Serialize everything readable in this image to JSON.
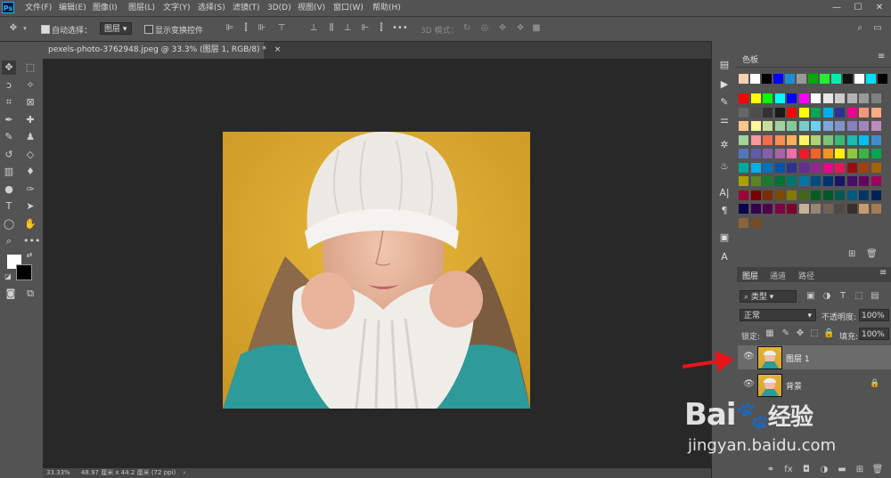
{
  "menu": [
    "文件(F)",
    "编辑(E)",
    "图像(I)",
    "图层(L)",
    "文字(Y)",
    "选择(S)",
    "滤镜(T)",
    "3D(D)",
    "视图(V)",
    "窗口(W)",
    "帮助(H)"
  ],
  "app_logo": "Ps",
  "options": {
    "auto_select_label": "自动选择：",
    "auto_select_target": "图层",
    "show_transform_label": "显示变换控件",
    "more": "•••",
    "mode_3d_label": "3D 模式："
  },
  "document": {
    "tab_title": "pexels-photo-3762948.jpeg @ 33.3% (图层 1, RGB/8) *",
    "close": "×"
  },
  "status": {
    "zoom": "33.33%",
    "doc_info": "48.97 厘米 x 44.2 厘米 (72 ppi)",
    "arrow": "›"
  },
  "swatches": {
    "title": "色板",
    "row0": [
      "#f5d2b5",
      "#ffffff",
      "#000000",
      "#0000ff",
      "#1b8fd1",
      "#999999",
      "#00aa00",
      "#22ee33",
      "#00eeaa",
      "#111111",
      "#ffffff",
      "#00ddff",
      "#000000"
    ],
    "rows": [
      [
        "#ff0000",
        "#ffff00",
        "#00ff00",
        "#00ffff",
        "#0000ff",
        "#ff00ff",
        "#ffffff",
        "#e6e6e6",
        "#cccccc",
        "#b3b3b3",
        "#999999",
        "#808080"
      ],
      [
        "#666666",
        "#4d4d4d",
        "#333333",
        "#1a1a1a",
        "#ff0000",
        "#ffff00",
        "#00a651",
        "#00aeef",
        "#2e3192",
        "#ec008c",
        "#f7977a",
        "#fbad82"
      ],
      [
        "#fdc68a",
        "#fff79a",
        "#c4df9b",
        "#a3d39c",
        "#82ca9c",
        "#7accc8",
        "#6dcff6",
        "#7da7d9",
        "#8393ca",
        "#8781bd",
        "#a186be",
        "#bd8cbf"
      ],
      [
        "#a2d39c",
        "#f6989d",
        "#f26c4f",
        "#f68e55",
        "#fbaf5c",
        "#fff467",
        "#acd372",
        "#7cc576",
        "#3bb878",
        "#1abbb4",
        "#00bff3",
        "#438ccb"
      ],
      [
        "#5574b9",
        "#605ca8",
        "#855fa8",
        "#a763a8",
        "#f06eaa",
        "#ed1c24",
        "#f26522",
        "#f7941d",
        "#fff200",
        "#8dc73f",
        "#39b54a",
        "#00a651"
      ],
      [
        "#00a99d",
        "#00aeef",
        "#0072bc",
        "#0054a6",
        "#2e3192",
        "#662d91",
        "#92278f",
        "#ec008c",
        "#ed145b",
        "#9e0b0f",
        "#a0410d",
        "#a3620a"
      ],
      [
        "#aba000",
        "#598527",
        "#1a7b30",
        "#007236",
        "#00746b",
        "#0076a3",
        "#004b80",
        "#003471",
        "#1b1464",
        "#440e62",
        "#630460",
        "#9e005d"
      ],
      [
        "#9e0039",
        "#790000",
        "#7b2e00",
        "#7d4900",
        "#827b00",
        "#406618",
        "#005e20",
        "#005826",
        "#005952",
        "#005b7f",
        "#003663",
        "#002157"
      ],
      [
        "#0d004c",
        "#32004b",
        "#4b0049",
        "#7b0046",
        "#7a0026",
        "#c7b299",
        "#998675",
        "#736357",
        "#534741",
        "#37302d",
        "#c69c6d",
        "#a67c52"
      ],
      [
        "#8c6239",
        "#754c24"
      ]
    ]
  },
  "layers_panel": {
    "tabs": [
      "图层",
      "通道",
      "路径"
    ],
    "filter_label": "类型",
    "blend_mode": "正常",
    "opacity_label": "不透明度:",
    "opacity_value": "100%",
    "lock_label": "锁定:",
    "fill_label": "填充:",
    "fill_value": "100%",
    "layers": [
      {
        "name": "图层 1",
        "selected": true,
        "locked": false
      },
      {
        "name": "背景",
        "selected": false,
        "locked": true
      }
    ],
    "footer_icons": [
      "link-icon",
      "fx-icon",
      "mask-icon",
      "adjustment-icon",
      "folder-icon",
      "new-layer-icon",
      "trash-icon"
    ]
  },
  "watermark": {
    "brand": "Bai",
    "brand2": "经验",
    "url": "jingyan.baidu.com"
  },
  "colors": {
    "accent_arrow": "#e8141b",
    "canvas_bg": "#282828",
    "panel_bg": "#535353"
  }
}
